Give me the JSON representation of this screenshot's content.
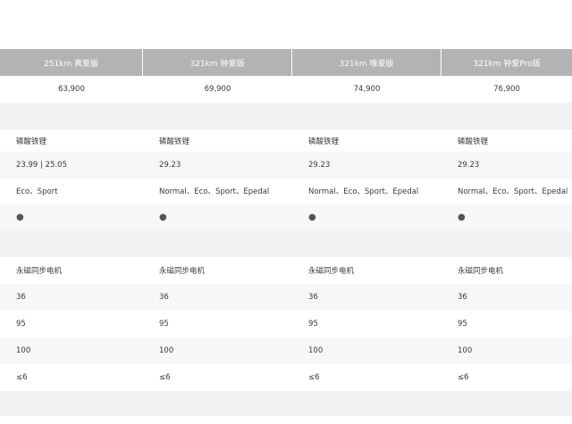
{
  "header": {
    "columns": [
      "251km 真爱版",
      "321km 钟爱版",
      "321km 唯爱版",
      "321km 钟爱Pro版"
    ]
  },
  "price_row": [
    "63,900",
    "69,900",
    "74,900",
    "76,900"
  ],
  "battery_section": {
    "rows": [
      {
        "cells": [
          "磷酸铁锂",
          "磷酸铁锂",
          "磷酸铁锂",
          "磷酸铁锂"
        ],
        "bg": "#ffffff"
      },
      {
        "cells": [
          "23.99 | 25.05",
          "29.23",
          "29.23",
          "29.23"
        ],
        "bg": "#f7f7f7"
      },
      {
        "cells": [
          "Eco、Sport",
          "Normal、Eco、Sport、Epedal",
          "Normal、Eco、Sport、Epedal",
          "Normal、Eco、Sport、Epedal"
        ],
        "bg": "#ffffff"
      },
      {
        "cells": [
          "●",
          "●",
          "●",
          "●"
        ],
        "bg": "#f7f7f7"
      }
    ]
  },
  "motor_section": {
    "rows": [
      {
        "cells": [
          "永磁同步电机",
          "永磁同步电机",
          "永磁同步电机",
          "永磁同步电机"
        ],
        "bg": "#ffffff"
      },
      {
        "cells": [
          "36",
          "36",
          "36",
          "36"
        ],
        "bg": "#f7f7f7"
      },
      {
        "cells": [
          "95",
          "95",
          "95",
          "95"
        ],
        "bg": "#ffffff"
      },
      {
        "cells": [
          "100",
          "100",
          "100",
          "100"
        ],
        "bg": "#f7f7f7"
      },
      {
        "cells": [
          "≤6",
          "≤6",
          "≤6",
          "≤6"
        ],
        "bg": "#ffffff"
      }
    ]
  },
  "colors": {
    "header_bg": "#b3b3b3",
    "section_bg": "#f2f2f2",
    "alt_row_bg": "#f7f7f7"
  }
}
